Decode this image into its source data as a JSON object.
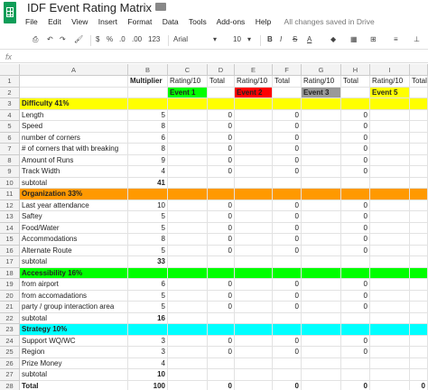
{
  "app": {
    "title": "IDF Event Rating Matrix",
    "status": "All changes saved in Drive"
  },
  "menu": [
    "File",
    "Edit",
    "View",
    "Insert",
    "Format",
    "Data",
    "Tools",
    "Add-ons",
    "Help"
  ],
  "toolbar": {
    "currency": "$",
    "percent": "%",
    "dec_less": ".0",
    "dec_more": ".00",
    "more_formats": "123",
    "font": "Arial",
    "font_size": "10",
    "bold": "B",
    "italic": "I",
    "strike": "S",
    "text_color": "A"
  },
  "formula_bar": {
    "fx": "fx",
    "value": ""
  },
  "columns": [
    "A",
    "B",
    "C",
    "D",
    "E",
    "F",
    "G",
    "H",
    "I"
  ],
  "colors": {
    "difficulty": "#ffff00",
    "organization": "#ff9900",
    "accessibility": "#00ff00",
    "strategy": "#00ffff",
    "event1": "#00ff00",
    "event2": "#ff0000",
    "event3": "#999999",
    "event5": "#ffff00"
  },
  "rows": [
    {
      "n": "1",
      "cells": [
        "",
        "Multiplier",
        "Rating/10",
        "Total",
        "Rating/10",
        "Total",
        "Rating/10",
        "Total",
        "Rating/10",
        "Total"
      ]
    },
    {
      "n": "2",
      "cells": [
        "",
        "",
        "Event 1",
        "",
        "Event 2",
        "",
        "Event 3",
        "",
        "Event 5",
        ""
      ]
    },
    {
      "n": "3",
      "cells": [
        "Difficulty 41%",
        "",
        "",
        "",
        "",
        "",
        "",
        "",
        "",
        ""
      ],
      "section": "difficulty"
    },
    {
      "n": "4",
      "cells": [
        "Length",
        "5",
        "",
        "0",
        "",
        "0",
        "",
        "0",
        "",
        ""
      ]
    },
    {
      "n": "5",
      "cells": [
        "Speed",
        "8",
        "",
        "0",
        "",
        "0",
        "",
        "0",
        "",
        ""
      ]
    },
    {
      "n": "6",
      "cells": [
        "number of corners",
        "6",
        "",
        "0",
        "",
        "0",
        "",
        "0",
        "",
        ""
      ]
    },
    {
      "n": "7",
      "cells": [
        "# of corners that with breaking",
        "8",
        "",
        "0",
        "",
        "0",
        "",
        "0",
        "",
        ""
      ]
    },
    {
      "n": "8",
      "cells": [
        "Amount of Runs",
        "9",
        "",
        "0",
        "",
        "0",
        "",
        "0",
        "",
        ""
      ]
    },
    {
      "n": "9",
      "cells": [
        "Track Width",
        "4",
        "",
        "0",
        "",
        "0",
        "",
        "0",
        "",
        ""
      ]
    },
    {
      "n": "10",
      "cells": [
        "subtotal",
        "41",
        "",
        "",
        "",
        "",
        "",
        "",
        "",
        ""
      ],
      "subtotal": true
    },
    {
      "n": "11",
      "cells": [
        "Organization 33%",
        "",
        "",
        "",
        "",
        "",
        "",
        "",
        "",
        ""
      ],
      "section": "organization"
    },
    {
      "n": "12",
      "cells": [
        "Last year attendance",
        "10",
        "",
        "0",
        "",
        "0",
        "",
        "0",
        "",
        ""
      ]
    },
    {
      "n": "13",
      "cells": [
        "Saftey",
        "5",
        "",
        "0",
        "",
        "0",
        "",
        "0",
        "",
        ""
      ]
    },
    {
      "n": "14",
      "cells": [
        "Food/Water",
        "5",
        "",
        "0",
        "",
        "0",
        "",
        "0",
        "",
        ""
      ]
    },
    {
      "n": "15",
      "cells": [
        "Accommodations",
        "8",
        "",
        "0",
        "",
        "0",
        "",
        "0",
        "",
        ""
      ]
    },
    {
      "n": "16",
      "cells": [
        "Alternate Route",
        "5",
        "",
        "0",
        "",
        "0",
        "",
        "0",
        "",
        ""
      ]
    },
    {
      "n": "17",
      "cells": [
        "subtotal",
        "33",
        "",
        "",
        "",
        "",
        "",
        "",
        "",
        ""
      ],
      "subtotal": true
    },
    {
      "n": "18",
      "cells": [
        "Accessibility 16%",
        "",
        "",
        "",
        "",
        "",
        "",
        "",
        "",
        ""
      ],
      "section": "accessibility"
    },
    {
      "n": "19",
      "cells": [
        "from airport",
        "6",
        "",
        "0",
        "",
        "0",
        "",
        "0",
        "",
        ""
      ]
    },
    {
      "n": "20",
      "cells": [
        "from accomadations",
        "5",
        "",
        "0",
        "",
        "0",
        "",
        "0",
        "",
        ""
      ]
    },
    {
      "n": "21",
      "cells": [
        "party / group interaction area",
        "5",
        "",
        "0",
        "",
        "0",
        "",
        "0",
        "",
        ""
      ]
    },
    {
      "n": "22",
      "cells": [
        "subtotal",
        "16",
        "",
        "",
        "",
        "",
        "",
        "",
        "",
        ""
      ],
      "subtotal": true
    },
    {
      "n": "23",
      "cells": [
        "Strategy 10%",
        "",
        "",
        "",
        "",
        "",
        "",
        "",
        "",
        ""
      ],
      "section": "strategy"
    },
    {
      "n": "24",
      "cells": [
        "Support WQ/WC",
        "3",
        "",
        "0",
        "",
        "0",
        "",
        "0",
        "",
        ""
      ]
    },
    {
      "n": "25",
      "cells": [
        "Region",
        "3",
        "",
        "0",
        "",
        "0",
        "",
        "0",
        "",
        ""
      ]
    },
    {
      "n": "26",
      "cells": [
        "Prize Money",
        "4",
        "",
        "",
        "",
        "",
        "",
        "",
        "",
        ""
      ]
    },
    {
      "n": "27",
      "cells": [
        "subtotal",
        "10",
        "",
        "",
        "",
        "",
        "",
        "",
        "",
        ""
      ],
      "subtotal": true
    },
    {
      "n": "28",
      "cells": [
        "Total",
        "100",
        "",
        "0",
        "",
        "0",
        "",
        "0",
        "",
        "0"
      ],
      "total": true
    }
  ]
}
